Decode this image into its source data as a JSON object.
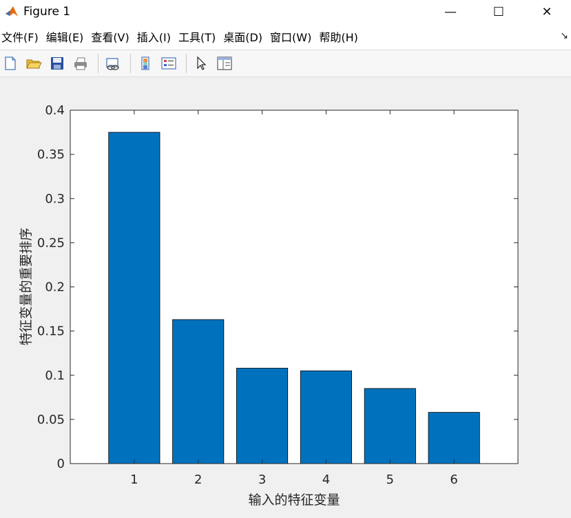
{
  "window": {
    "title": "Figure 1",
    "minimize_label": "—",
    "maximize_label": "☐",
    "close_label": "✕"
  },
  "menu": {
    "items": [
      "文件(F)",
      "编辑(E)",
      "查看(V)",
      "插入(I)",
      "工具(T)",
      "桌面(D)",
      "窗口(W)",
      "帮助(H)"
    ],
    "overflow_arrow": "↘"
  },
  "toolbar": {
    "icons": [
      "new-figure-icon",
      "open-file-icon",
      "save-icon",
      "print-icon",
      "link-plot-icon",
      "insert-colorbar-icon",
      "insert-legend-icon",
      "pointer-icon",
      "property-editor-icon"
    ]
  },
  "colors": {
    "bar_fill": "#0072BD",
    "bar_edge": "#000000",
    "axes_bg": "#ffffff",
    "figure_bg": "#f0f0f0"
  },
  "chart_data": {
    "type": "bar",
    "categories": [
      "1",
      "2",
      "3",
      "4",
      "5",
      "6"
    ],
    "values": [
      0.375,
      0.163,
      0.108,
      0.105,
      0.085,
      0.058
    ],
    "title": "",
    "xlabel": "输入的特征变量",
    "ylabel": "特征变量的重要排序",
    "ylim": [
      0,
      0.4
    ],
    "xlim": [
      0,
      7
    ],
    "yticks": [
      "0",
      "0.05",
      "0.1",
      "0.15",
      "0.2",
      "0.25",
      "0.3",
      "0.35",
      "0.4"
    ],
    "grid": false,
    "legend": "none"
  }
}
